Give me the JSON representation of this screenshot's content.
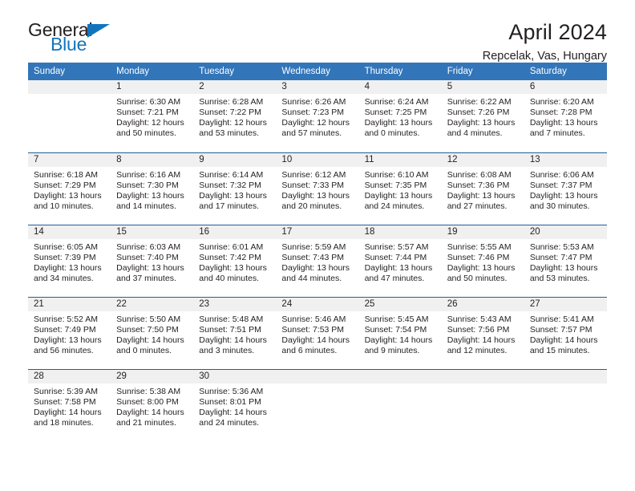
{
  "logo": {
    "part1": "General",
    "part2": "Blue",
    "triangle_color": "#1275bc",
    "text_color": "#231f20"
  },
  "header": {
    "title": "April 2024",
    "subtitle": "Repcelak, Vas, Hungary"
  },
  "theme": {
    "header_bg": "#3275b9",
    "header_text": "#ffffff",
    "row_divider": "#1f5fa0",
    "daynum_band": "#f0f0f0",
    "body_text": "#231f20"
  },
  "weekdays": [
    "Sunday",
    "Monday",
    "Tuesday",
    "Wednesday",
    "Thursday",
    "Friday",
    "Saturday"
  ],
  "weeks": [
    [
      {
        "day": "",
        "sunrise": "",
        "sunset": "",
        "daylight1": "",
        "daylight2": ""
      },
      {
        "day": "1",
        "sunrise": "Sunrise: 6:30 AM",
        "sunset": "Sunset: 7:21 PM",
        "daylight1": "Daylight: 12 hours",
        "daylight2": "and 50 minutes."
      },
      {
        "day": "2",
        "sunrise": "Sunrise: 6:28 AM",
        "sunset": "Sunset: 7:22 PM",
        "daylight1": "Daylight: 12 hours",
        "daylight2": "and 53 minutes."
      },
      {
        "day": "3",
        "sunrise": "Sunrise: 6:26 AM",
        "sunset": "Sunset: 7:23 PM",
        "daylight1": "Daylight: 12 hours",
        "daylight2": "and 57 minutes."
      },
      {
        "day": "4",
        "sunrise": "Sunrise: 6:24 AM",
        "sunset": "Sunset: 7:25 PM",
        "daylight1": "Daylight: 13 hours",
        "daylight2": "and 0 minutes."
      },
      {
        "day": "5",
        "sunrise": "Sunrise: 6:22 AM",
        "sunset": "Sunset: 7:26 PM",
        "daylight1": "Daylight: 13 hours",
        "daylight2": "and 4 minutes."
      },
      {
        "day": "6",
        "sunrise": "Sunrise: 6:20 AM",
        "sunset": "Sunset: 7:28 PM",
        "daylight1": "Daylight: 13 hours",
        "daylight2": "and 7 minutes."
      }
    ],
    [
      {
        "day": "7",
        "sunrise": "Sunrise: 6:18 AM",
        "sunset": "Sunset: 7:29 PM",
        "daylight1": "Daylight: 13 hours",
        "daylight2": "and 10 minutes."
      },
      {
        "day": "8",
        "sunrise": "Sunrise: 6:16 AM",
        "sunset": "Sunset: 7:30 PM",
        "daylight1": "Daylight: 13 hours",
        "daylight2": "and 14 minutes."
      },
      {
        "day": "9",
        "sunrise": "Sunrise: 6:14 AM",
        "sunset": "Sunset: 7:32 PM",
        "daylight1": "Daylight: 13 hours",
        "daylight2": "and 17 minutes."
      },
      {
        "day": "10",
        "sunrise": "Sunrise: 6:12 AM",
        "sunset": "Sunset: 7:33 PM",
        "daylight1": "Daylight: 13 hours",
        "daylight2": "and 20 minutes."
      },
      {
        "day": "11",
        "sunrise": "Sunrise: 6:10 AM",
        "sunset": "Sunset: 7:35 PM",
        "daylight1": "Daylight: 13 hours",
        "daylight2": "and 24 minutes."
      },
      {
        "day": "12",
        "sunrise": "Sunrise: 6:08 AM",
        "sunset": "Sunset: 7:36 PM",
        "daylight1": "Daylight: 13 hours",
        "daylight2": "and 27 minutes."
      },
      {
        "day": "13",
        "sunrise": "Sunrise: 6:06 AM",
        "sunset": "Sunset: 7:37 PM",
        "daylight1": "Daylight: 13 hours",
        "daylight2": "and 30 minutes."
      }
    ],
    [
      {
        "day": "14",
        "sunrise": "Sunrise: 6:05 AM",
        "sunset": "Sunset: 7:39 PM",
        "daylight1": "Daylight: 13 hours",
        "daylight2": "and 34 minutes."
      },
      {
        "day": "15",
        "sunrise": "Sunrise: 6:03 AM",
        "sunset": "Sunset: 7:40 PM",
        "daylight1": "Daylight: 13 hours",
        "daylight2": "and 37 minutes."
      },
      {
        "day": "16",
        "sunrise": "Sunrise: 6:01 AM",
        "sunset": "Sunset: 7:42 PM",
        "daylight1": "Daylight: 13 hours",
        "daylight2": "and 40 minutes."
      },
      {
        "day": "17",
        "sunrise": "Sunrise: 5:59 AM",
        "sunset": "Sunset: 7:43 PM",
        "daylight1": "Daylight: 13 hours",
        "daylight2": "and 44 minutes."
      },
      {
        "day": "18",
        "sunrise": "Sunrise: 5:57 AM",
        "sunset": "Sunset: 7:44 PM",
        "daylight1": "Daylight: 13 hours",
        "daylight2": "and 47 minutes."
      },
      {
        "day": "19",
        "sunrise": "Sunrise: 5:55 AM",
        "sunset": "Sunset: 7:46 PM",
        "daylight1": "Daylight: 13 hours",
        "daylight2": "and 50 minutes."
      },
      {
        "day": "20",
        "sunrise": "Sunrise: 5:53 AM",
        "sunset": "Sunset: 7:47 PM",
        "daylight1": "Daylight: 13 hours",
        "daylight2": "and 53 minutes."
      }
    ],
    [
      {
        "day": "21",
        "sunrise": "Sunrise: 5:52 AM",
        "sunset": "Sunset: 7:49 PM",
        "daylight1": "Daylight: 13 hours",
        "daylight2": "and 56 minutes."
      },
      {
        "day": "22",
        "sunrise": "Sunrise: 5:50 AM",
        "sunset": "Sunset: 7:50 PM",
        "daylight1": "Daylight: 14 hours",
        "daylight2": "and 0 minutes."
      },
      {
        "day": "23",
        "sunrise": "Sunrise: 5:48 AM",
        "sunset": "Sunset: 7:51 PM",
        "daylight1": "Daylight: 14 hours",
        "daylight2": "and 3 minutes."
      },
      {
        "day": "24",
        "sunrise": "Sunrise: 5:46 AM",
        "sunset": "Sunset: 7:53 PM",
        "daylight1": "Daylight: 14 hours",
        "daylight2": "and 6 minutes."
      },
      {
        "day": "25",
        "sunrise": "Sunrise: 5:45 AM",
        "sunset": "Sunset: 7:54 PM",
        "daylight1": "Daylight: 14 hours",
        "daylight2": "and 9 minutes."
      },
      {
        "day": "26",
        "sunrise": "Sunrise: 5:43 AM",
        "sunset": "Sunset: 7:56 PM",
        "daylight1": "Daylight: 14 hours",
        "daylight2": "and 12 minutes."
      },
      {
        "day": "27",
        "sunrise": "Sunrise: 5:41 AM",
        "sunset": "Sunset: 7:57 PM",
        "daylight1": "Daylight: 14 hours",
        "daylight2": "and 15 minutes."
      }
    ],
    [
      {
        "day": "28",
        "sunrise": "Sunrise: 5:39 AM",
        "sunset": "Sunset: 7:58 PM",
        "daylight1": "Daylight: 14 hours",
        "daylight2": "and 18 minutes."
      },
      {
        "day": "29",
        "sunrise": "Sunrise: 5:38 AM",
        "sunset": "Sunset: 8:00 PM",
        "daylight1": "Daylight: 14 hours",
        "daylight2": "and 21 minutes."
      },
      {
        "day": "30",
        "sunrise": "Sunrise: 5:36 AM",
        "sunset": "Sunset: 8:01 PM",
        "daylight1": "Daylight: 14 hours",
        "daylight2": "and 24 minutes."
      },
      {
        "day": "",
        "sunrise": "",
        "sunset": "",
        "daylight1": "",
        "daylight2": ""
      },
      {
        "day": "",
        "sunrise": "",
        "sunset": "",
        "daylight1": "",
        "daylight2": ""
      },
      {
        "day": "",
        "sunrise": "",
        "sunset": "",
        "daylight1": "",
        "daylight2": ""
      },
      {
        "day": "",
        "sunrise": "",
        "sunset": "",
        "daylight1": "",
        "daylight2": ""
      }
    ]
  ]
}
